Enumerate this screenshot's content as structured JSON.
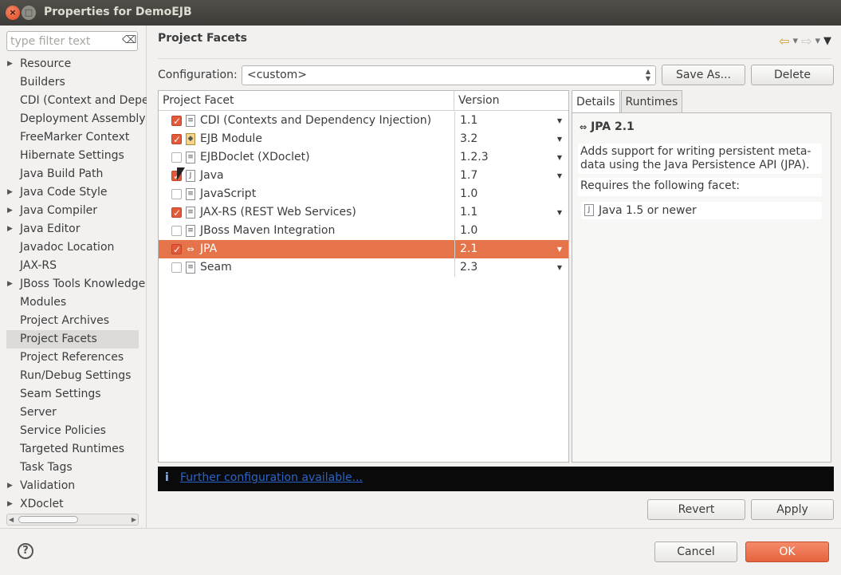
{
  "window": {
    "title": "Properties for DemoEJB"
  },
  "filter": {
    "placeholder": "type filter text"
  },
  "tree": [
    {
      "label": "Resource",
      "expandable": true
    },
    {
      "label": "Builders",
      "expandable": false
    },
    {
      "label": "CDI (Context and Depe",
      "expandable": false
    },
    {
      "label": "Deployment Assembly",
      "expandable": false
    },
    {
      "label": "FreeMarker Context",
      "expandable": false
    },
    {
      "label": "Hibernate Settings",
      "expandable": false
    },
    {
      "label": "Java Build Path",
      "expandable": false
    },
    {
      "label": "Java Code Style",
      "expandable": true
    },
    {
      "label": "Java Compiler",
      "expandable": true
    },
    {
      "label": "Java Editor",
      "expandable": true
    },
    {
      "label": "Javadoc Location",
      "expandable": false
    },
    {
      "label": "JAX-RS",
      "expandable": false
    },
    {
      "label": "JBoss Tools Knowledge",
      "expandable": true
    },
    {
      "label": "Modules",
      "expandable": false
    },
    {
      "label": "Project Archives",
      "expandable": false
    },
    {
      "label": "Project Facets",
      "expandable": false,
      "selected": true
    },
    {
      "label": "Project References",
      "expandable": false
    },
    {
      "label": "Run/Debug Settings",
      "expandable": false
    },
    {
      "label": "Seam Settings",
      "expandable": false
    },
    {
      "label": "Server",
      "expandable": false
    },
    {
      "label": "Service Policies",
      "expandable": false
    },
    {
      "label": "Targeted Runtimes",
      "expandable": false
    },
    {
      "label": "Task Tags",
      "expandable": false
    },
    {
      "label": "Validation",
      "expandable": true
    },
    {
      "label": "XDoclet",
      "expandable": true
    }
  ],
  "main": {
    "title": "Project Facets",
    "configuration_label": "Configuration:",
    "configuration_value": "<custom>",
    "save_as_label": "Save As...",
    "delete_label": "Delete"
  },
  "table": {
    "col_facet": "Project Facet",
    "col_version": "Version",
    "rows": [
      {
        "name": "CDI (Contexts and Dependency Injection)",
        "version": "1.1",
        "checked": true,
        "dropdown": true,
        "icon": "file-icon"
      },
      {
        "name": "EJB Module",
        "version": "3.2",
        "checked": true,
        "dropdown": true,
        "icon": "ejb-module-icon"
      },
      {
        "name": "EJBDoclet (XDoclet)",
        "version": "1.2.3",
        "checked": false,
        "dropdown": true,
        "icon": "file-icon"
      },
      {
        "name": "Java",
        "version": "1.7",
        "checked": true,
        "dropdown": true,
        "icon": "java-file-icon"
      },
      {
        "name": "JavaScript",
        "version": "1.0",
        "checked": false,
        "dropdown": false,
        "icon": "file-icon"
      },
      {
        "name": "JAX-RS (REST Web Services)",
        "version": "1.1",
        "checked": true,
        "dropdown": true,
        "icon": "file-icon"
      },
      {
        "name": "JBoss Maven Integration",
        "version": "1.0",
        "checked": false,
        "dropdown": false,
        "icon": "file-icon"
      },
      {
        "name": "JPA",
        "version": "2.1",
        "checked": true,
        "dropdown": true,
        "icon": "jpa-icon",
        "selected": true
      },
      {
        "name": "Seam",
        "version": "2.3",
        "checked": false,
        "dropdown": true,
        "icon": "file-icon"
      }
    ]
  },
  "details": {
    "tab_details": "Details",
    "tab_runtimes": "Runtimes",
    "title": "JPA 2.1",
    "description": "Adds support for writing persistent meta-data using the Java Persistence API (JPA).",
    "requires_label": "Requires the following facet:",
    "required_facet": "Java 1.5 or newer"
  },
  "info": {
    "link": "Further configuration available..."
  },
  "buttons": {
    "revert": "Revert",
    "apply": "Apply",
    "cancel": "Cancel",
    "ok": "OK",
    "help": "?"
  },
  "colors": {
    "accent": "#e6744a",
    "ok_button": "#e5643f",
    "info_bar": "#0a0a0a"
  }
}
